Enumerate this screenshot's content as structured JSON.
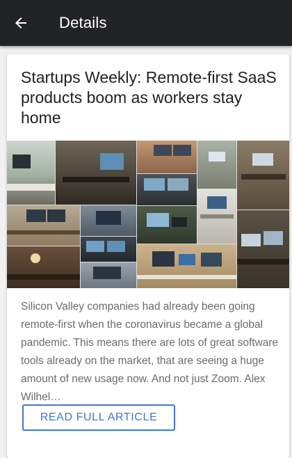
{
  "appbar": {
    "back_icon": "arrow-left-icon",
    "title": "Details"
  },
  "article": {
    "title": "Startups Weekly: Remote-first SaaS products boom as workers stay home",
    "excerpt": "Silicon Valley companies had already been going remote-first when the coronavirus became a global pandemic. This means there are lots of great software tools already on the market, that are seeing a huge amount of new usage now. And not just Zoom. Alex Wilhel…",
    "read_label": "READ FULL ARTICLE"
  },
  "colors": {
    "appbar_bg": "#222326",
    "accent": "#3f76d4",
    "title_text": "#212121",
    "body_text": "#6b6b6b",
    "page_bg": "#f1f1f1"
  }
}
